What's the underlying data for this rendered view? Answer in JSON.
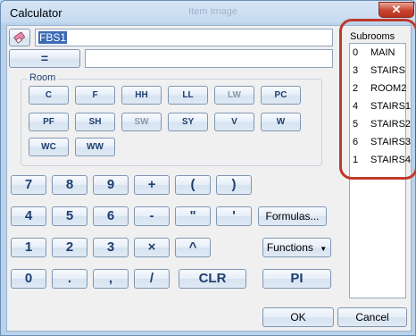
{
  "window": {
    "title": "Calculator",
    "ghost_label": "Item Image",
    "close_symbol": "✕"
  },
  "input": {
    "value": "FBS1",
    "result": ""
  },
  "equals_label": "=",
  "room_group": {
    "label": "Room",
    "buttons": [
      {
        "label": "C",
        "disabled": false
      },
      {
        "label": "F",
        "disabled": false
      },
      {
        "label": "HH",
        "disabled": false
      },
      {
        "label": "LL",
        "disabled": false
      },
      {
        "label": "LW",
        "disabled": true
      },
      {
        "label": "PC",
        "disabled": false
      },
      {
        "label": "PF",
        "disabled": false
      },
      {
        "label": "SH",
        "disabled": false
      },
      {
        "label": "SW",
        "disabled": true
      },
      {
        "label": "SY",
        "disabled": false
      },
      {
        "label": "V",
        "disabled": false
      },
      {
        "label": "W",
        "disabled": false
      },
      {
        "label": "WC",
        "disabled": false
      },
      {
        "label": "WW",
        "disabled": false
      }
    ]
  },
  "keypad": [
    [
      "7",
      "8",
      "9",
      "+",
      "(",
      ")"
    ],
    [
      "4",
      "5",
      "6",
      "-",
      "\"",
      "'"
    ],
    [
      "1",
      "2",
      "3",
      "×",
      "^"
    ],
    [
      "0",
      ".",
      ",",
      "/"
    ]
  ],
  "formulas_label": "Formulas...",
  "functions_label": "Functions",
  "clr_label": "CLR",
  "pi_label": "PI",
  "ok_label": "OK",
  "cancel_label": "Cancel",
  "subrooms": {
    "title": "Subrooms",
    "items": [
      {
        "num": "0",
        "name": "MAIN"
      },
      {
        "num": "3",
        "name": "STAIRS"
      },
      {
        "num": "2",
        "name": "ROOM2"
      },
      {
        "num": "4",
        "name": "STAIRS1"
      },
      {
        "num": "5",
        "name": "STAIRS2"
      },
      {
        "num": "6",
        "name": "STAIRS3"
      },
      {
        "num": "1",
        "name": "STAIRS4"
      }
    ]
  }
}
